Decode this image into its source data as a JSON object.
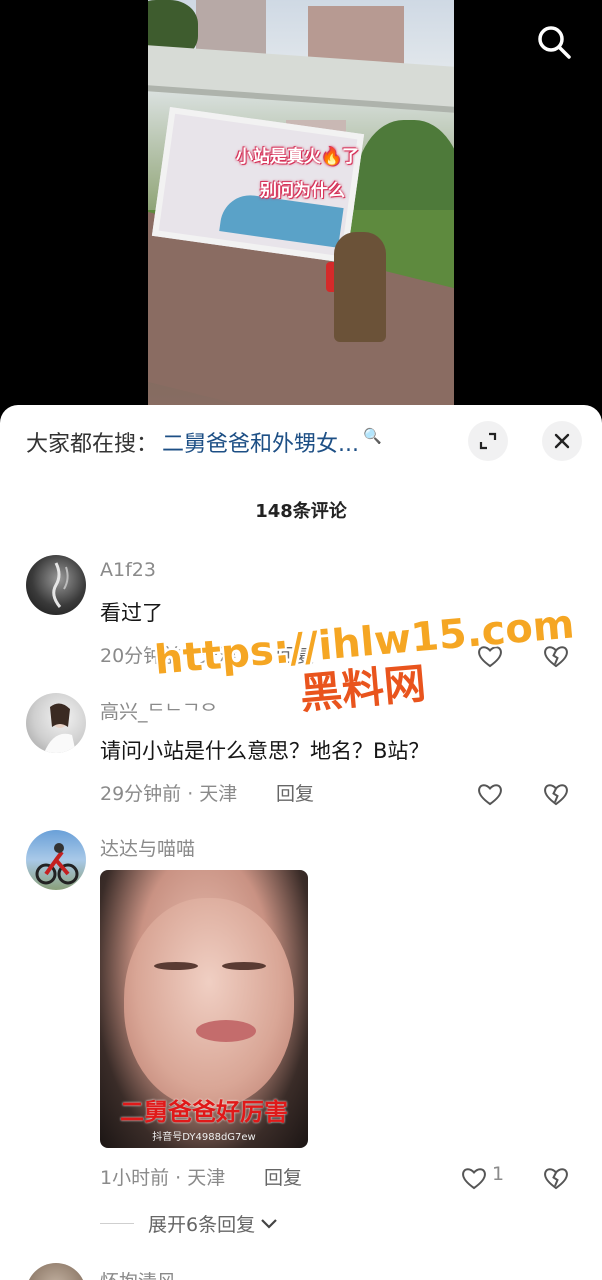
{
  "video": {
    "caption_line1": "小站是真火🔥了",
    "caption_line2": "别问为什么"
  },
  "header": {
    "search_prefix": "大家都在搜：",
    "search_query": "二舅爸爸和外甥女...",
    "search_mag": "🔍"
  },
  "comment_count": "148条评论",
  "comments": [
    {
      "username": "A1f23",
      "text": "看过了",
      "meta": "20分钟前 · 天津",
      "reply": "回复"
    },
    {
      "username": "高兴_ᄃᄂᄀᄋ",
      "text": "请问小站是什么意思？地名？B站？",
      "meta": "29分钟前 · 天津",
      "reply": "回复"
    },
    {
      "username": "达达与喵喵",
      "image_caption": "二舅爸爸好厉害",
      "image_watermark": "抖音号DY4988dG7ew",
      "meta": "1小时前 · 天津",
      "reply": "回复",
      "likes": "1",
      "expand": "展开6条回复"
    },
    {
      "username": "怀抱清风"
    }
  ],
  "watermark": {
    "line1": "https://ihlw15.com",
    "line2": "黑料网"
  },
  "colors": {
    "link_blue": "#1d4f85",
    "watermark_orange": "#f5a623",
    "watermark_red": "#e9541d"
  },
  "icons": {
    "search": "search-icon",
    "expand": "expand-icon",
    "close": "close-icon",
    "like": "heart-icon",
    "dislike": "broken-heart-icon",
    "chevron": "chevron-down-icon"
  }
}
